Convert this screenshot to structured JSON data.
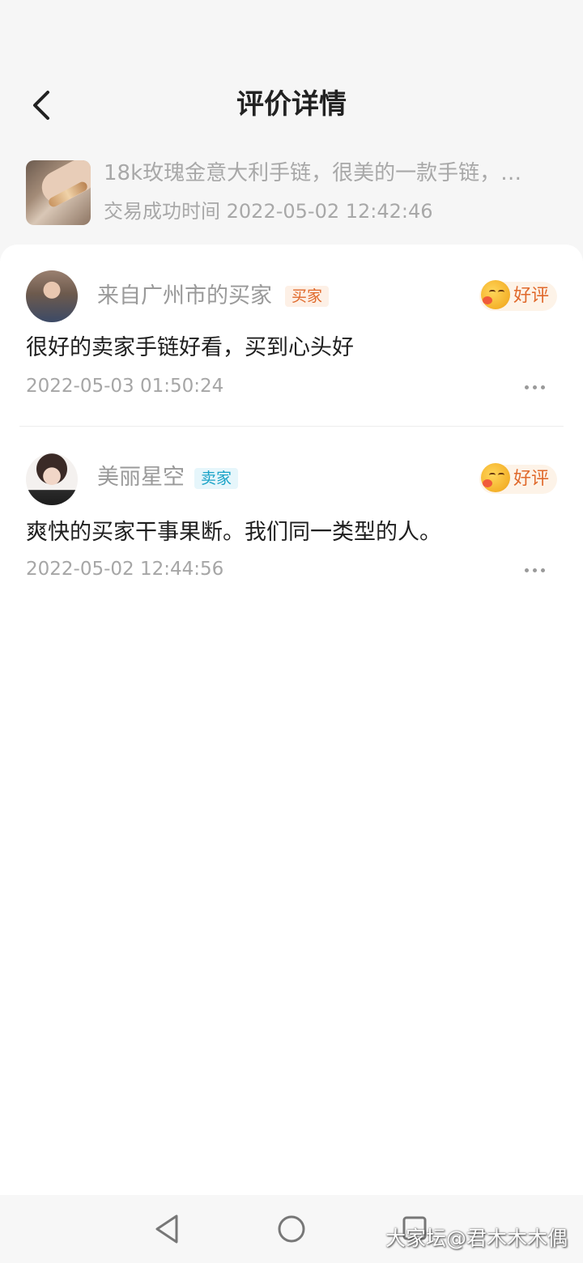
{
  "header": {
    "title": "评价详情"
  },
  "product": {
    "title": "18k玫瑰金意大利手链，很美的一款手链，…",
    "time_label": "交易成功时间",
    "time_value": "2022-05-02 12:42:46"
  },
  "reviews": [
    {
      "nickname": "来自广州市的买家",
      "role": "买家",
      "rating": "好评",
      "text": "很好的卖家手链好看，买到心头好",
      "time": "2022-05-03 01:50:24"
    },
    {
      "nickname": "美丽星空",
      "role": "卖家",
      "rating": "好评",
      "text": "爽快的买家干事果断。我们同一类型的人。",
      "time": "2022-05-02 12:44:56"
    }
  ],
  "watermark": "大家坛@君木木木偶",
  "colors": {
    "buyer_tag": "#e0692b",
    "seller_tag": "#1aa3c7",
    "rating_label": "#e0692b"
  },
  "icons": {
    "back": "chevron-left-icon",
    "more": "more-dots-icon",
    "rating": "smile-kiss-icon",
    "nav_back": "triangle-back-icon",
    "nav_home": "circle-home-icon",
    "nav_recent": "square-recent-icon"
  }
}
